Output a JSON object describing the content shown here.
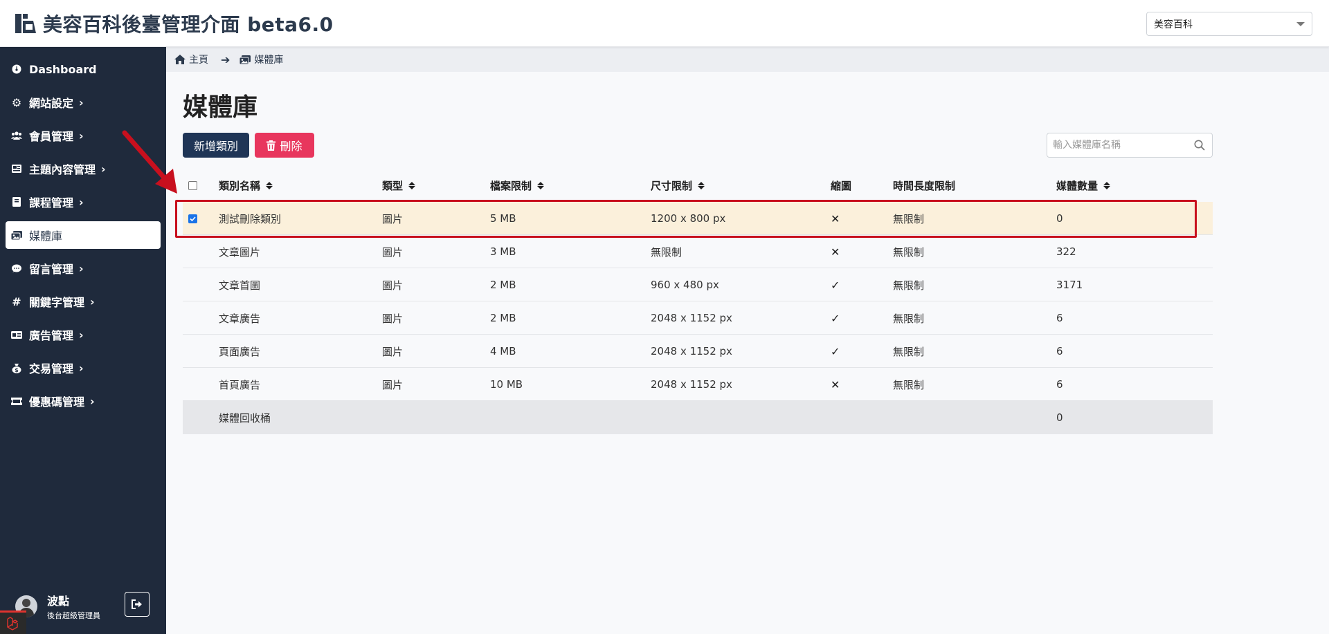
{
  "header": {
    "title": "美容百科後臺管理介面 beta6.0",
    "site_select": "美容百科"
  },
  "sidebar": {
    "items": [
      {
        "label": "Dashboard",
        "icon": "dashboard-icon"
      },
      {
        "label": "網站設定",
        "icon": "gear-icon",
        "chevron": "›"
      },
      {
        "label": "會員管理",
        "icon": "users-icon",
        "chevron": "›"
      },
      {
        "label": "主題內容管理",
        "icon": "content-icon",
        "chevron": "›"
      },
      {
        "label": "課程管理",
        "icon": "book-icon",
        "chevron": "›"
      },
      {
        "label": "媒體庫",
        "icon": "images-icon",
        "active": true
      },
      {
        "label": "留言管理",
        "icon": "comment-icon",
        "chevron": "›"
      },
      {
        "label": "關鍵字管理",
        "icon": "hashtag-icon",
        "chevron": "›"
      },
      {
        "label": "廣告管理",
        "icon": "ad-icon",
        "chevron": "›"
      },
      {
        "label": "交易管理",
        "icon": "money-bag-icon",
        "chevron": "›"
      },
      {
        "label": "優惠碼管理",
        "icon": "ticket-icon",
        "chevron": "›"
      }
    ],
    "user": {
      "name": "波點",
      "role": "後台超級管理員"
    }
  },
  "breadcrumb": {
    "home": "主頁",
    "current": "媒體庫"
  },
  "page": {
    "title": "媒體庫",
    "add_button": "新增類別",
    "delete_button": "刪除",
    "search_placeholder": "輸入媒體庫名稱"
  },
  "table": {
    "headers": {
      "name": "類別名稱",
      "type": "類型",
      "file_limit": "檔案限制",
      "size_limit": "尺寸限制",
      "thumbnail": "縮圖",
      "duration": "時間長度限制",
      "count": "媒體數量"
    },
    "rows": [
      {
        "name": "測試刪除類別",
        "type": "圖片",
        "file": "5 MB",
        "size": "1200 x 800 px",
        "thumb": "✕",
        "duration": "無限制",
        "count": "0",
        "checked": true
      },
      {
        "name": "文章圖片",
        "type": "圖片",
        "file": "3 MB",
        "size": "無限制",
        "thumb": "✕",
        "duration": "無限制",
        "count": "322"
      },
      {
        "name": "文章首圖",
        "type": "圖片",
        "file": "2 MB",
        "size": "960 x 480 px",
        "thumb": "✓",
        "duration": "無限制",
        "count": "3171"
      },
      {
        "name": "文章廣告",
        "type": "圖片",
        "file": "2 MB",
        "size": "2048 x 1152 px",
        "thumb": "✓",
        "duration": "無限制",
        "count": "6"
      },
      {
        "name": "頁面廣告",
        "type": "圖片",
        "file": "4 MB",
        "size": "2048 x 1152 px",
        "thumb": "✓",
        "duration": "無限制",
        "count": "6"
      },
      {
        "name": "首頁廣告",
        "type": "圖片",
        "file": "10 MB",
        "size": "2048 x 1152 px",
        "thumb": "✕",
        "duration": "無限制",
        "count": "6"
      }
    ],
    "trash_row": {
      "name": "媒體回收桶",
      "count": "0"
    }
  },
  "colors": {
    "sidebar_bg": "#1f2a3c",
    "primary_button": "#1f3556",
    "danger_button": "#e8365d",
    "selected_row": "#fbf0db",
    "annotation_red": "#c8101e"
  }
}
